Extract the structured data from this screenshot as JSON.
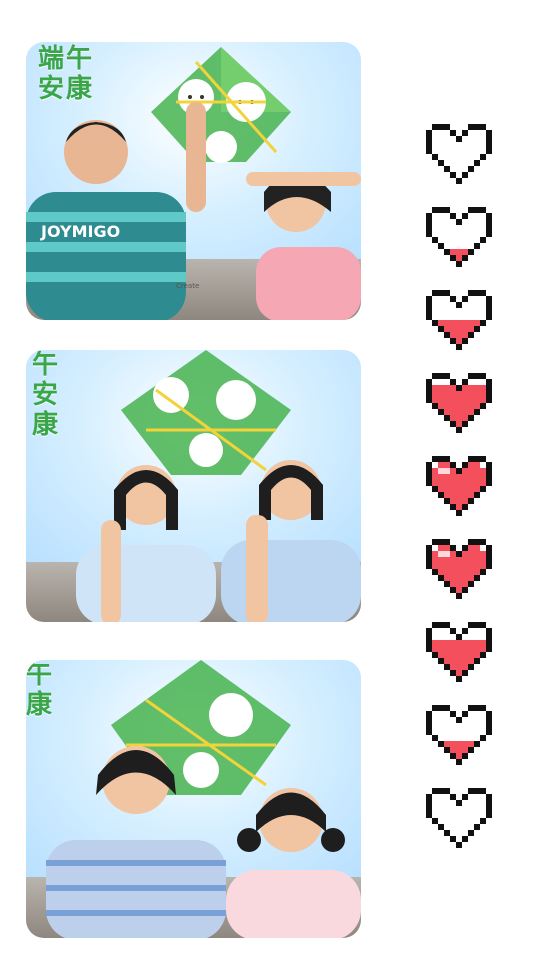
{
  "photos": [
    {
      "caption": "端午安康",
      "small_text": "Create",
      "shirt_text": "JOYMIGO"
    },
    {
      "caption": "端午安康"
    },
    {
      "caption": "端午安康"
    }
  ],
  "hearts": [
    {
      "fill_level": 0.0
    },
    {
      "fill_level": 0.1
    },
    {
      "fill_level": 0.4
    },
    {
      "fill_level": 0.7
    },
    {
      "fill_level": 1.0
    },
    {
      "fill_level": 1.0
    },
    {
      "fill_level": 0.6
    },
    {
      "fill_level": 0.3
    },
    {
      "fill_level": 0.0
    }
  ],
  "colors": {
    "heart_fill": "#f34f5d",
    "heart_highlight": "#ffd6d9",
    "outline": "#111111",
    "calligraphy": "#3aa64a"
  }
}
